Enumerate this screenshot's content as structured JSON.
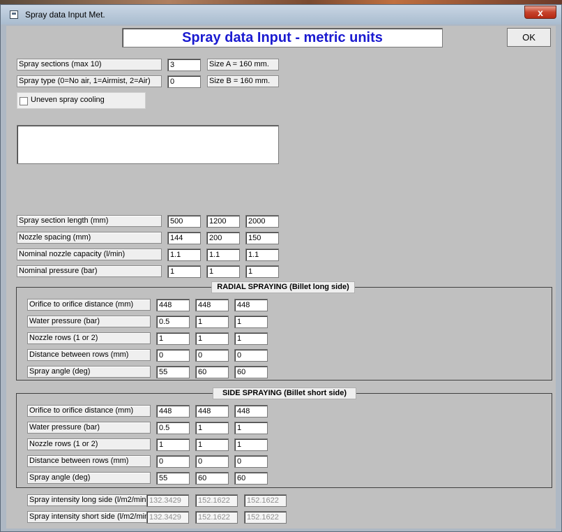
{
  "window": {
    "title": "Spray data Input Met.",
    "close_label": "x"
  },
  "header": {
    "title": "Spray data Input - metric units",
    "ok_label": "OK"
  },
  "general": {
    "spray_sections_label": "Spray sections (max 10)",
    "spray_sections_value": "3",
    "spray_type_label": "Spray type (0=No air, 1=Airmist, 2=Air)",
    "spray_type_value": "0",
    "size_a": "Size A = 160 mm.",
    "size_b": "Size B = 160 mm.",
    "uneven_label": "Uneven spray cooling",
    "uneven_checked": false
  },
  "sections": [
    {
      "label": "Spray section length (mm)",
      "values": [
        "500",
        "1200",
        "2000"
      ]
    },
    {
      "label": "Nozzle spacing (mm)",
      "values": [
        "144",
        "200",
        "150"
      ]
    },
    {
      "label": "Nominal nozzle capacity (l/min)",
      "values": [
        "1.1",
        "1.1",
        "1.1"
      ]
    },
    {
      "label": "Nominal pressure (bar)",
      "values": [
        "1",
        "1",
        "1"
      ]
    }
  ],
  "radial": {
    "title": "RADIAL SPRAYING (Billet long side)",
    "rows": [
      {
        "label": "Orifice to orifice distance (mm)",
        "values": [
          "448",
          "448",
          "448"
        ]
      },
      {
        "label": "Water pressure (bar)",
        "values": [
          "0.5",
          "1",
          "1"
        ]
      },
      {
        "label": "Nozzle rows (1 or 2)",
        "values": [
          "1",
          "1",
          "1"
        ]
      },
      {
        "label": "Distance between rows (mm)",
        "values": [
          "0",
          "0",
          "0"
        ]
      },
      {
        "label": "Spray angle (deg)",
        "values": [
          "55",
          "60",
          "60"
        ]
      }
    ]
  },
  "side": {
    "title": "SIDE SPRAYING (Billet short side)",
    "rows": [
      {
        "label": "Orifice to orifice distance (mm)",
        "values": [
          "448",
          "448",
          "448"
        ]
      },
      {
        "label": "Water pressure (bar)",
        "values": [
          "0.5",
          "1",
          "1"
        ]
      },
      {
        "label": "Nozzle rows (1 or 2)",
        "values": [
          "1",
          "1",
          "1"
        ]
      },
      {
        "label": "Distance between rows (mm)",
        "values": [
          "0",
          "0",
          "0"
        ]
      },
      {
        "label": "Spray angle (deg)",
        "values": [
          "55",
          "60",
          "60"
        ]
      }
    ]
  },
  "intensity": [
    {
      "label": "Spray intensity long side (l/m2/min)",
      "values": [
        "132.3429",
        "152.1622",
        "152.1622"
      ]
    },
    {
      "label": "Spray intensity short side (l/m2/min)",
      "values": [
        "132.3429",
        "152.1622",
        "152.1622"
      ]
    }
  ]
}
